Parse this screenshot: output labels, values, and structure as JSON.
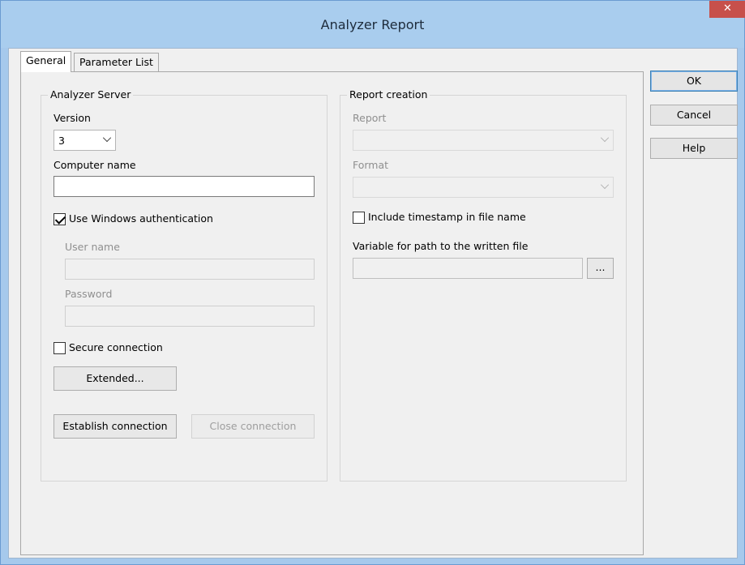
{
  "window": {
    "title": "Analyzer Report",
    "close_glyph": "✕"
  },
  "tabs": [
    {
      "label": "General",
      "active": true
    },
    {
      "label": "Parameter List",
      "active": false
    }
  ],
  "analyzer_server": {
    "group_title": "Analyzer Server",
    "version_label": "Version",
    "version_value": "3",
    "computer_name_label": "Computer name",
    "computer_name_value": "",
    "use_windows_auth_label": "Use Windows authentication",
    "use_windows_auth_checked": true,
    "user_name_label": "User name",
    "user_name_value": "",
    "password_label": "Password",
    "password_value": "",
    "secure_connection_label": "Secure connection",
    "secure_connection_checked": false,
    "extended_button": "Extended...",
    "establish_button": "Establish connection",
    "close_button": "Close connection"
  },
  "report_creation": {
    "group_title": "Report creation",
    "report_label": "Report",
    "report_value": "",
    "format_label": "Format",
    "format_value": "",
    "include_timestamp_label": "Include timestamp in file name",
    "include_timestamp_checked": false,
    "variable_path_label": "Variable for path to the written file",
    "variable_path_value": "",
    "browse_button": "..."
  },
  "dialog_buttons": {
    "ok": "OK",
    "cancel": "Cancel",
    "help": "Help"
  }
}
